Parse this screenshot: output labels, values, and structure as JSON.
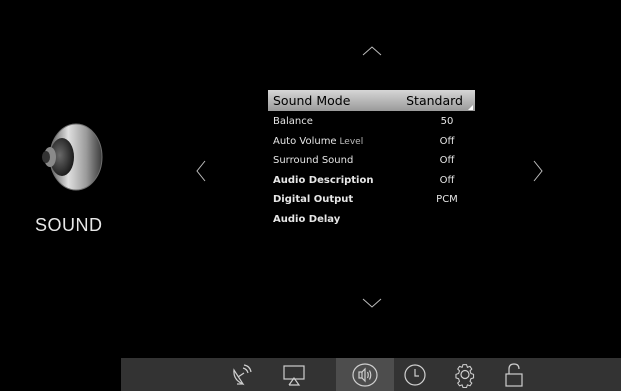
{
  "section": {
    "title": "SOUND",
    "icon": "speaker-icon"
  },
  "navigation": {
    "up_icon": "chevron-up-icon",
    "down_icon": "chevron-down-icon",
    "left_icon": "chevron-left-icon",
    "right_icon": "chevron-right-icon"
  },
  "menu": {
    "items": [
      {
        "label": "Sound Mode",
        "value": "Standard"
      },
      {
        "label": "Balance",
        "value": "50"
      },
      {
        "label_main": "Auto Volume",
        "label_suffix": " Level",
        "value": "Off"
      },
      {
        "label": "Surround Sound",
        "value": "Off"
      },
      {
        "label": "Audio Description",
        "value": "Off"
      },
      {
        "label": "Digital Output",
        "value": "PCM"
      },
      {
        "label": "Audio Delay",
        "value": ""
      }
    ]
  },
  "bottom_bar": {
    "icons": [
      "satellite-icon",
      "picture-icon",
      "sound-icon",
      "clock-icon",
      "settings-icon",
      "lock-icon"
    ],
    "active": "sound-icon"
  },
  "colors": {
    "background": "#000000",
    "selected_row": "#c8c8c8",
    "bar": "#333333",
    "bar_active": "#4d4d4d"
  }
}
